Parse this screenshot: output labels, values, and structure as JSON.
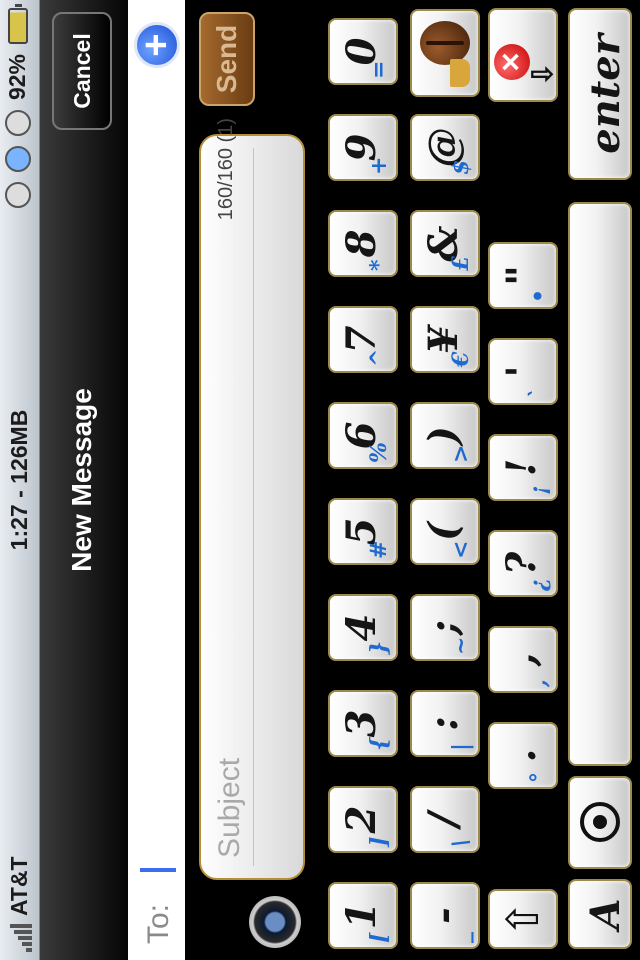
{
  "status_bar": {
    "carrier": "AT&T",
    "center_text": "1:27 - 126MB",
    "battery_percent": "92%"
  },
  "nav": {
    "title": "New Message",
    "cancel_label": "Cancel"
  },
  "to_row": {
    "label": "To:"
  },
  "compose": {
    "subject_placeholder": "Subject",
    "counter": "160/160 (1)",
    "send_label": "Send"
  },
  "keyboard": {
    "row1": [
      {
        "main": "1",
        "shift": "["
      },
      {
        "main": "2",
        "shift": "]"
      },
      {
        "main": "3",
        "shift": "{"
      },
      {
        "main": "4",
        "shift": "}"
      },
      {
        "main": "5",
        "shift": "#"
      },
      {
        "main": "6",
        "shift": "%"
      },
      {
        "main": "7",
        "shift": "^"
      },
      {
        "main": "8",
        "shift": "*"
      },
      {
        "main": "9",
        "shift": "+"
      },
      {
        "main": "0",
        "shift": "="
      }
    ],
    "row2": [
      {
        "main": "-",
        "shift": "_"
      },
      {
        "main": "/",
        "shift": "\\"
      },
      {
        "main": ":",
        "shift": "|"
      },
      {
        "main": ";",
        "shift": "~"
      },
      {
        "main": "(",
        "shift": "<"
      },
      {
        "main": ")",
        "shift": ">"
      },
      {
        "main": "¥",
        "shift": "€"
      },
      {
        "main": "&",
        "shift": "£"
      },
      {
        "main": "@",
        "shift": "$"
      }
    ],
    "row3": [
      {
        "main": ".",
        "shift": "°"
      },
      {
        "main": ",",
        "shift": ","
      },
      {
        "main": "?",
        "shift": "¿"
      },
      {
        "main": "!",
        "shift": "¡"
      },
      {
        "main": "'",
        "shift": "`"
      },
      {
        "main": "\"",
        "shift": "•"
      }
    ],
    "enter_label": "enter",
    "shift_icon": "shift-arrow-icon",
    "delete_icon": "delete-icon",
    "coffee_icon": "coffee-icon",
    "space_icon": "target-icon",
    "font_label": "A"
  }
}
